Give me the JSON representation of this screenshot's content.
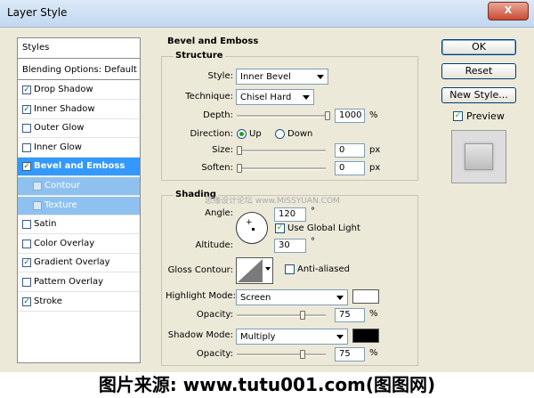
{
  "window": {
    "title": "Layer Style",
    "close_glyph": "X"
  },
  "styles_list": {
    "header": "Styles",
    "blending": "Blending Options: Default",
    "items": [
      {
        "label": "Drop Shadow",
        "checked": true
      },
      {
        "label": "Inner Shadow",
        "checked": true
      },
      {
        "label": "Outer Glow",
        "checked": false
      },
      {
        "label": "Inner Glow",
        "checked": false
      },
      {
        "label": "Bevel and Emboss",
        "checked": true
      },
      {
        "label": "Contour",
        "checked": false
      },
      {
        "label": "Texture",
        "checked": false
      },
      {
        "label": "Satin",
        "checked": false
      },
      {
        "label": "Color Overlay",
        "checked": false
      },
      {
        "label": "Gradient Overlay",
        "checked": true
      },
      {
        "label": "Pattern Overlay",
        "checked": false
      },
      {
        "label": "Stroke",
        "checked": true
      }
    ]
  },
  "bevel": {
    "title": "Bevel and Emboss",
    "structure": {
      "title": "Structure",
      "style_label": "Style:",
      "style_value": "Inner Bevel",
      "technique_label": "Technique:",
      "technique_value": "Chisel Hard",
      "depth_label": "Depth:",
      "depth_value": "1000",
      "depth_unit": "%",
      "depth_fraction": 1.0,
      "direction_label": "Direction:",
      "dir_up": "Up",
      "dir_down": "Down",
      "size_label": "Size:",
      "size_value": "0",
      "size_unit": "px",
      "soften_label": "Soften:",
      "soften_value": "0",
      "soften_unit": "px"
    },
    "shading": {
      "title": "Shading",
      "angle_label": "Angle:",
      "angle_value": "120",
      "degree": "°",
      "global_light": "Use Global Light",
      "altitude_label": "Altitude:",
      "altitude_value": "30",
      "gloss_label": "Gloss Contour:",
      "anti_aliased": "Anti-aliased",
      "highlight_label": "Highlight Mode:",
      "highlight_value": "Screen",
      "highlight_color": "#ffffff",
      "opacity_label": "Opacity:",
      "hl_opacity": "75",
      "shadow_label": "Shadow Mode:",
      "shadow_value": "Multiply",
      "shadow_color": "#000000",
      "sh_opacity": "75",
      "percent": "%",
      "opacity_fraction": 0.75
    }
  },
  "buttons": {
    "ok": "OK",
    "reset": "Reset",
    "new_style": "New Style...",
    "preview": "Preview"
  },
  "watermark": {
    "site_text": "思缘设计论坛 www.MISSYUAN.COM",
    "source": "图片来源: www.tutu001.com(图图网)"
  }
}
